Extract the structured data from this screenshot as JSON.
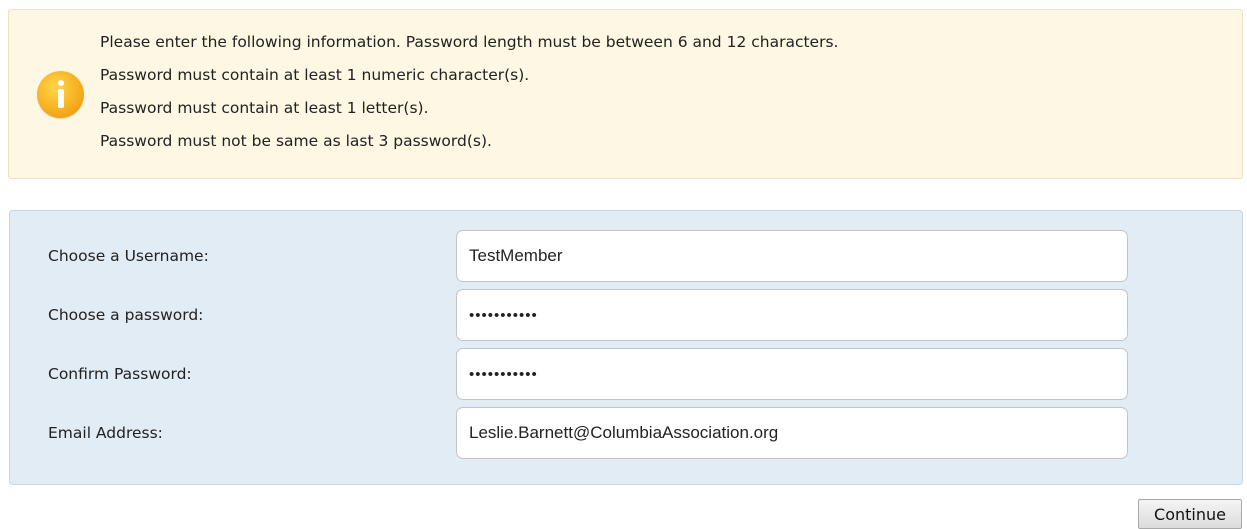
{
  "info": {
    "icon": "info-icon",
    "icon_color": "#f7b021",
    "lines": [
      "Please enter the following information. Password length must be between 6 and 12 characters.",
      "Password must contain at least 1 numeric character(s).",
      "Password must contain at least 1 letter(s).",
      "Password must not be same as last 3 password(s)."
    ]
  },
  "form": {
    "username": {
      "label": "Choose a Username:",
      "value": "TestMember"
    },
    "password": {
      "label": "Choose a password:",
      "value": "•••••••••••"
    },
    "confirm_password": {
      "label": "Confirm Password:",
      "value": "•••••••••••"
    },
    "email": {
      "label": "Email Address:",
      "value": "Leslie.Barnett@ColumbiaAssociation.org"
    }
  },
  "actions": {
    "continue_label": "Continue"
  },
  "colors": {
    "info_background": "#fdf7e3",
    "form_background": "#e1ecf5"
  }
}
